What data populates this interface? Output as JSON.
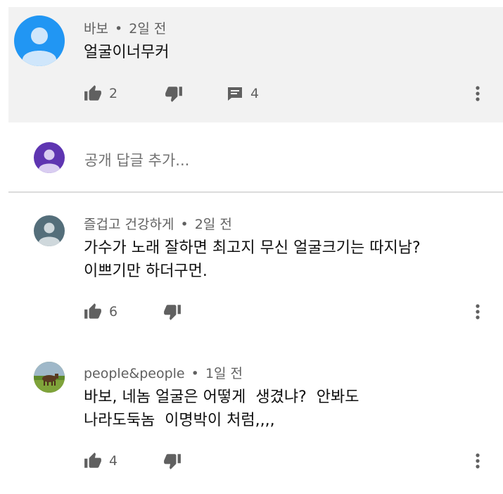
{
  "comments": [
    {
      "author": "바보",
      "sep": "•",
      "time": "2일 전",
      "lines": [
        "얼굴이너무커"
      ],
      "likes": "2",
      "replies": "4",
      "avatar": "default-avatar-blue"
    },
    {
      "author": "즐겁고 건강하게",
      "sep": "•",
      "time": "2일 전",
      "lines": [
        "가수가 노래 잘하면 최고지 무신 얼굴크기는 따지남?",
        "이쁘기만 하더구먼."
      ],
      "likes": "6",
      "avatar": "default-avatar-gray"
    },
    {
      "author": "people&people",
      "sep": "•",
      "time": "1일 전",
      "lines": [
        "바보, 네놈 얼굴은 어떻게  생겼냐?  안봐도",
        "나라도둑놈  이명박이 처럼,,,,"
      ],
      "likes": "4",
      "avatar": "photo-avatar-animal"
    }
  ],
  "reply_box": {
    "placeholder": "공개 답글 추가...",
    "avatar": "default-avatar-purple"
  },
  "colors": {
    "highlight_bg": "#f2f2f2",
    "avatar_blue": "#2196f3",
    "avatar_purple": "#5e35b1",
    "avatar_gray": "#546e7a",
    "icon_gray": "#606060"
  },
  "icons": {
    "like": "thumb-up-icon",
    "dislike": "thumb-down-icon",
    "reply": "comment-icon",
    "more": "more-vertical-icon"
  }
}
